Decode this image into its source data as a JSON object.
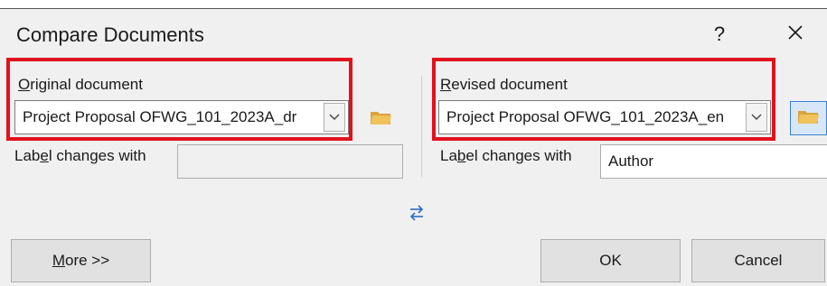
{
  "dialog": {
    "title": "Compare Documents",
    "help_label": "?",
    "close_icon": "close-icon"
  },
  "original": {
    "label_prefix": "",
    "label_mnemonic": "O",
    "label_rest": "riginal document",
    "value": "Project Proposal OFWG_101_2023A_dr",
    "changes_label_prefix": "Lab",
    "changes_label_mnemonic": "e",
    "changes_label_rest": "l changes with",
    "changes_value": ""
  },
  "revised": {
    "label_prefix": "",
    "label_mnemonic": "R",
    "label_rest": "evised document",
    "value": "Project Proposal OFWG_101_2023A_en",
    "changes_label_prefix": "La",
    "changes_label_mnemonic": "b",
    "changes_label_rest": "el changes with",
    "changes_value": "Author"
  },
  "buttons": {
    "more_mnemonic": "M",
    "more_rest": "ore >>",
    "ok": "OK",
    "cancel": "Cancel"
  },
  "icons": {
    "swap": "swap-arrows-icon",
    "folder": "folder-icon",
    "dropdown": "chevron-down-icon"
  },
  "colors": {
    "highlight": "#e0121d",
    "folder": "#e8b64a",
    "swap": "#2b6cc4"
  }
}
